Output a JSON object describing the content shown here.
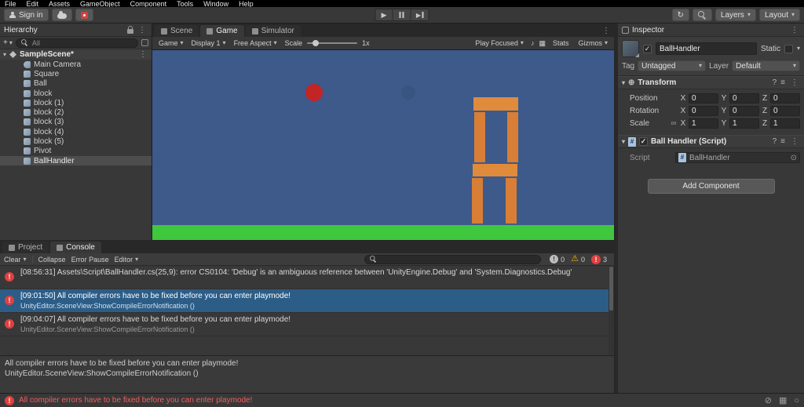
{
  "colors": {
    "sky": "#3d5a8b",
    "ground": "#3fc73e",
    "ball": "#c32424",
    "ghost": "#375580",
    "block": "#e08a3c",
    "block2": "#d87e36",
    "selection": "#2c5d87",
    "error": "#e04040"
  },
  "icons": {
    "kebab": "⋮",
    "dropdown": "▾",
    "foldout": "▾",
    "play": "▶",
    "plus": "+",
    "help": "?",
    "presets": "≡",
    "picker": "⊙",
    "link": "∞",
    "transform": "⊕",
    "script_hash": "#",
    "check": "✓",
    "speaker": "♪",
    "grid": "▦",
    "history": "↻",
    "muted_bell": "⊘",
    "package": "▦",
    "activity": "○",
    "warning": "⚠"
  },
  "menubar": {
    "items": [
      "File",
      "Edit",
      "Assets",
      "GameObject",
      "Component",
      "Tools",
      "Window",
      "Help"
    ]
  },
  "toolbar": {
    "sign_in": "Sign in",
    "layers": "Layers",
    "layout": "Layout"
  },
  "hierarchy": {
    "title": "Hierarchy",
    "search_placeholder": "All",
    "scene_label": "SampleScene*",
    "items": [
      "Main Camera",
      "Square",
      "Ball",
      "block",
      "block (1)",
      "block (2)",
      "block (3)",
      "block (4)",
      "block (5)",
      "Pivot",
      "BallHandler"
    ]
  },
  "viewport": {
    "tab_scene": "Scene",
    "tab_game": "Game",
    "tab_simulator": "Simulator",
    "tb_game": "Game",
    "tb_display": "Display 1",
    "tb_aspect": "Free Aspect",
    "tb_scale_label": "Scale",
    "tb_scale_value": "1x",
    "tb_play_focused": "Play Focused",
    "tb_stats": "Stats",
    "tb_gizmos": "Gizmos"
  },
  "inspector": {
    "title": "Inspector",
    "object_name": "BallHandler",
    "static_label": "Static",
    "tag_label": "Tag",
    "tag_value": "Untagged",
    "layer_label": "Layer",
    "layer_value": "Default",
    "transform": {
      "title": "Transform",
      "axis": {
        "x": "X",
        "y": "Y",
        "z": "Z"
      },
      "position_label": "Position",
      "position": {
        "x": "0",
        "y": "0",
        "z": "0"
      },
      "rotation_label": "Rotation",
      "rotation": {
        "x": "0",
        "y": "0",
        "z": "0"
      },
      "scale_label": "Scale",
      "scale": {
        "x": "1",
        "y": "1",
        "z": "1"
      }
    },
    "script_component": {
      "title": "Ball Handler (Script)",
      "script_label": "Script",
      "script_value": "BallHandler"
    },
    "add_component_label": "Add Component"
  },
  "console": {
    "tab_project": "Project",
    "tab_console": "Console",
    "clear_label": "Clear",
    "collapse_label": "Collapse",
    "error_pause_label": "Error Pause",
    "editor_label": "Editor",
    "info_count": "0",
    "warning_count": "0",
    "error_count": "3",
    "entries": [
      {
        "line1": "[08:56:31] Assets\\Script\\BallHandler.cs(25,9): error CS0104: 'Debug' is an ambiguous reference between 'UnityEngine.Debug' and 'System.Diagnostics.Debug'",
        "line2": ""
      },
      {
        "line1": "[09:01:50] All compiler errors have to be fixed before you can enter playmode!",
        "line2": "UnityEditor.SceneView:ShowCompileErrorNotification ()"
      },
      {
        "line1": "[09:04:07] All compiler errors have to be fixed before you can enter playmode!",
        "line2": "UnityEditor.SceneView:ShowCompileErrorNotification ()"
      }
    ],
    "detail_line1": "All compiler errors have to be fixed before you can enter playmode!",
    "detail_line2": "UnityEditor.SceneView:ShowCompileErrorNotification ()"
  },
  "statusbar": {
    "message": "All compiler errors have to be fixed before you can enter playmode!"
  }
}
